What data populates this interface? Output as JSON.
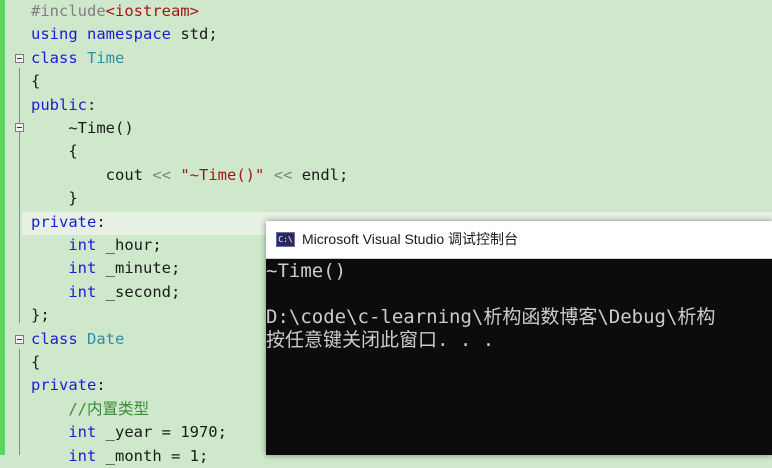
{
  "editor": {
    "lines": [
      {
        "segs": [
          {
            "t": "#include",
            "c": "pre"
          },
          {
            "t": "<iostream>",
            "c": "inc"
          }
        ]
      },
      {
        "segs": [
          {
            "t": "using",
            "c": "kw"
          },
          {
            "t": " "
          },
          {
            "t": "namespace",
            "c": "kw"
          },
          {
            "t": " std;"
          }
        ]
      },
      {
        "segs": [
          {
            "t": "class",
            "c": "kw"
          },
          {
            "t": " "
          },
          {
            "t": "Time",
            "c": "ty"
          }
        ]
      },
      {
        "segs": [
          {
            "t": "{"
          }
        ]
      },
      {
        "segs": [
          {
            "t": "public",
            "c": "kw"
          },
          {
            "t": ":"
          }
        ]
      },
      {
        "segs": [
          {
            "t": "    ~Time()"
          }
        ]
      },
      {
        "segs": [
          {
            "t": "    {"
          }
        ]
      },
      {
        "segs": [
          {
            "t": "        cout "
          },
          {
            "t": "<<",
            "c": "op"
          },
          {
            "t": " "
          },
          {
            "t": "\"~Time()\"",
            "c": "str"
          },
          {
            "t": " "
          },
          {
            "t": "<<",
            "c": "op"
          },
          {
            "t": " endl;"
          }
        ]
      },
      {
        "segs": [
          {
            "t": "    }"
          }
        ]
      },
      {
        "segs": [
          {
            "t": "private",
            "c": "kw"
          },
          {
            "t": ":"
          }
        ]
      },
      {
        "segs": [
          {
            "t": "    "
          },
          {
            "t": "int",
            "c": "kw"
          },
          {
            "t": " _hour;"
          }
        ]
      },
      {
        "segs": [
          {
            "t": "    "
          },
          {
            "t": "int",
            "c": "kw"
          },
          {
            "t": " _minute;"
          }
        ]
      },
      {
        "segs": [
          {
            "t": "    "
          },
          {
            "t": "int",
            "c": "kw"
          },
          {
            "t": " _second;"
          }
        ]
      },
      {
        "segs": [
          {
            "t": "};"
          }
        ]
      },
      {
        "segs": [
          {
            "t": "class",
            "c": "kw"
          },
          {
            "t": " "
          },
          {
            "t": "Date",
            "c": "ty"
          }
        ]
      },
      {
        "segs": [
          {
            "t": "{"
          }
        ]
      },
      {
        "segs": [
          {
            "t": "private",
            "c": "kw"
          },
          {
            "t": ":"
          }
        ]
      },
      {
        "segs": [
          {
            "t": "    "
          },
          {
            "t": "//内置类型",
            "c": "cm"
          }
        ]
      },
      {
        "segs": [
          {
            "t": "    "
          },
          {
            "t": "int",
            "c": "kw"
          },
          {
            "t": " _year = 1970;"
          }
        ]
      },
      {
        "segs": [
          {
            "t": "    "
          },
          {
            "t": "int",
            "c": "kw"
          },
          {
            "t": " _month = 1;"
          }
        ]
      }
    ]
  },
  "console": {
    "title": "Microsoft Visual Studio 调试控制台",
    "icon": "console-app-icon",
    "icon_text": "C:\\",
    "output": [
      "~Time()",
      "",
      "D:\\code\\c-learning\\析构函数博客\\Debug\\析构",
      "按任意键关闭此窗口. . ."
    ]
  }
}
